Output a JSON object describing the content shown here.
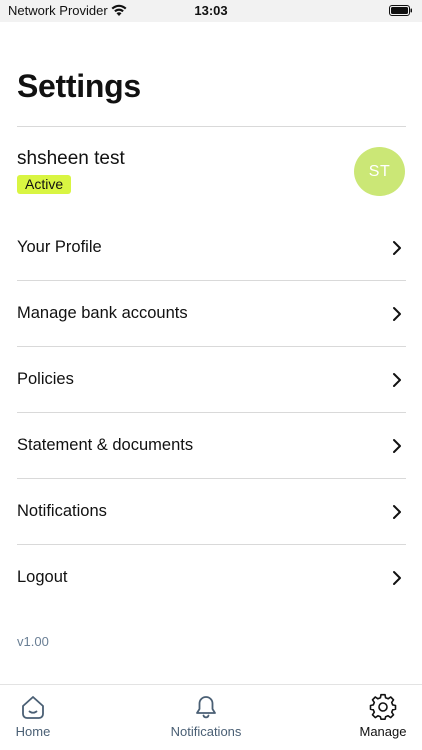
{
  "status_bar": {
    "carrier": "Network Provider",
    "time": "13:03"
  },
  "page": {
    "title": "Settings"
  },
  "profile": {
    "name": "shsheen test",
    "status": "Active",
    "initials": "ST"
  },
  "menu": {
    "items": [
      {
        "label": "Your Profile"
      },
      {
        "label": "Manage bank accounts"
      },
      {
        "label": "Policies"
      },
      {
        "label": "Statement & documents"
      },
      {
        "label": "Notifications"
      },
      {
        "label": "Logout"
      }
    ]
  },
  "version": "v1.00",
  "tab_bar": {
    "tabs": [
      {
        "label": "Home",
        "icon": "home-icon"
      },
      {
        "label": "Notifications",
        "icon": "bell-icon"
      },
      {
        "label": "Manage",
        "icon": "gear-icon",
        "active": true
      }
    ]
  },
  "colors": {
    "badge": "#d9f542",
    "avatar": "#cbe776",
    "muted_text": "#6a7f95"
  }
}
